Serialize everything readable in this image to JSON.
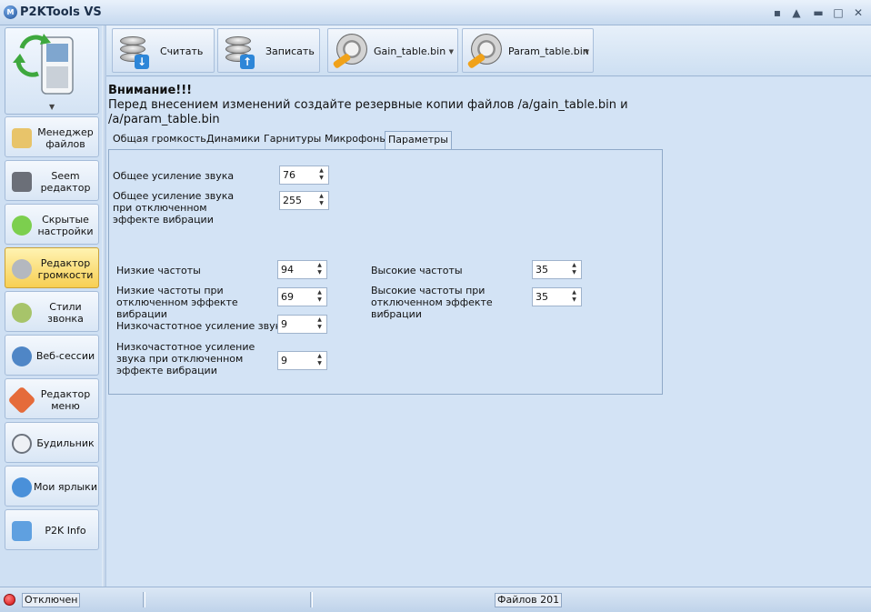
{
  "app": {
    "title": "P2KTools VS",
    "logo_letter": "M"
  },
  "window_controls": {
    "minimize_all": "▪",
    "restore_up": "▲",
    "minimize": "▬",
    "maximize": "□",
    "close": "✕"
  },
  "sidebar": {
    "items": [
      {
        "label": "Менеджер файлов"
      },
      {
        "label": "Seem редактор"
      },
      {
        "label": "Скрытые настройки"
      },
      {
        "label": "Редактор громкости"
      },
      {
        "label": "Стили звонка"
      },
      {
        "label": "Веб-сессии"
      },
      {
        "label": "Редактор меню"
      },
      {
        "label": "Будильник"
      },
      {
        "label": "Мои ярлыки"
      },
      {
        "label": "P2K Info"
      }
    ],
    "active_index": 3
  },
  "toolbar": {
    "read_label": "Считать",
    "write_label": "Записать",
    "gain_label": "Gain_table.bin",
    "param_label": "Param_table.bin"
  },
  "warning": {
    "title": "Внимание!!!",
    "line1": "Перед внесением изменений создайте резервные копии файлов /a/gain_table.bin и",
    "line2": "/a/param_table.bin"
  },
  "tabs": [
    "Общая громкость",
    "Динамики",
    "Гарнитуры",
    "Микрофоны",
    "Параметры"
  ],
  "active_tab": "Параметры",
  "params": {
    "overall_gain": {
      "label": "Общее усиление звука",
      "value": "76"
    },
    "overall_gain_novib": {
      "label": "Общее усиление звука при отключенном эффекте вибрации",
      "value": "255"
    },
    "low_freq": {
      "label": "Низкие частоты",
      "value": "94"
    },
    "low_freq_novib": {
      "label": "Низкие частоты при отключенном эффекте вибрации",
      "value": "69"
    },
    "lf_gain": {
      "label": "Низкочастотное усиление звука",
      "value": "9"
    },
    "lf_gain_novib": {
      "label": "Низкочастотное усиление звука при отключенном эффекте вибрации",
      "value": "9"
    },
    "high_freq": {
      "label": "Высокие частоты",
      "value": "35"
    },
    "high_freq_novib": {
      "label": "Высокие частоты при отключенном эффекте вибрации",
      "value": "35"
    }
  },
  "status": {
    "connection": "Отключен",
    "files": "Файлов 201",
    "color_disconnected": "#d10a0a"
  }
}
